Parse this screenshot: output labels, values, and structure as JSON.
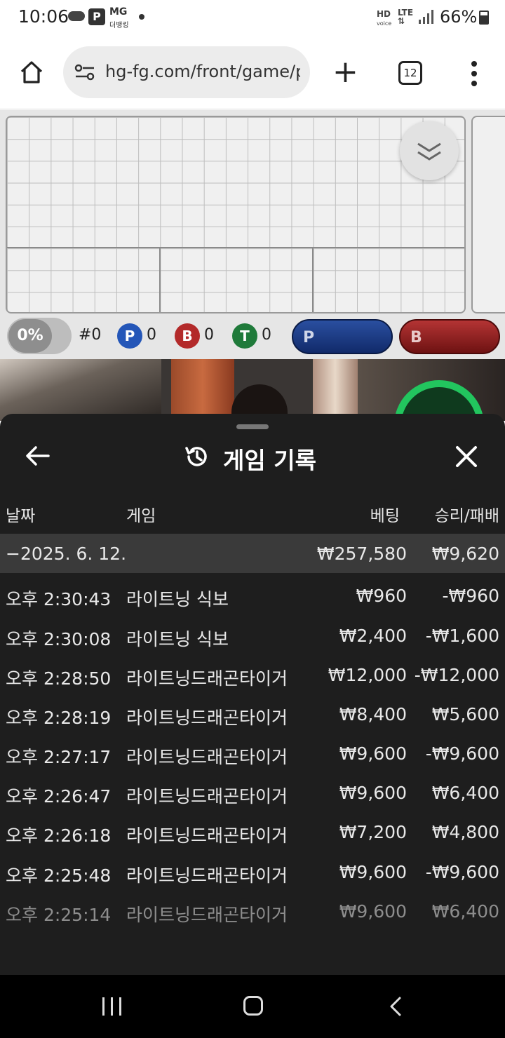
{
  "status_bar": {
    "time": "10:06",
    "app_badge": "P",
    "mg_label": "MG",
    "mg_sub": "더뱅킹",
    "hd_label": "HD",
    "hd_sub": "voice",
    "lte_label": "LTE",
    "battery": "66%"
  },
  "browser": {
    "url": "hg-fg.com/front/game/pla",
    "tab_count": "12"
  },
  "game_stats": {
    "percent": "0%",
    "round": "#0",
    "player_label": "P",
    "player_count": "0",
    "banker_label": "B",
    "banker_count": "0",
    "tie_label": "T",
    "tie_count": "0",
    "player_bet_label": "P",
    "banker_bet_label": "B"
  },
  "sheet": {
    "title": "게임 기록",
    "columns": {
      "date": "날짜",
      "game": "게임",
      "bet": "베팅",
      "win_loss": "승리/패배"
    },
    "summary": {
      "date": "−2025. 6. 12.",
      "bet": "₩257,580",
      "win_loss": "₩9,620"
    },
    "rows": [
      {
        "time": "오후 2:30:43",
        "game": "라이트닝 식보",
        "bet": "₩960",
        "win_loss": "-₩960"
      },
      {
        "time": "오후 2:30:08",
        "game": "라이트닝 식보",
        "bet": "₩2,400",
        "win_loss": "-₩1,600"
      },
      {
        "time": "오후 2:28:50",
        "game": "라이트닝드래곤타이거",
        "bet": "₩12,000",
        "win_loss": "-₩12,000"
      },
      {
        "time": "오후 2:28:19",
        "game": "라이트닝드래곤타이거",
        "bet": "₩8,400",
        "win_loss": "₩5,600"
      },
      {
        "time": "오후 2:27:17",
        "game": "라이트닝드래곤타이거",
        "bet": "₩9,600",
        "win_loss": "-₩9,600"
      },
      {
        "time": "오후 2:26:47",
        "game": "라이트닝드래곤타이거",
        "bet": "₩9,600",
        "win_loss": "₩6,400"
      },
      {
        "time": "오후 2:26:18",
        "game": "라이트닝드래곤타이거",
        "bet": "₩7,200",
        "win_loss": "₩4,800"
      },
      {
        "time": "오후 2:25:48",
        "game": "라이트닝드래곤타이거",
        "bet": "₩9,600",
        "win_loss": "-₩9,600"
      },
      {
        "time": "오후 2:25:14",
        "game": "라이트닝드래곤타이거",
        "bet": "₩9,600",
        "win_loss": "₩6,400"
      }
    ]
  },
  "colors": {
    "player": "#2456b8",
    "banker": "#b32a2a",
    "tie": "#1f7a3a",
    "sheet_bg": "#1e1e1e",
    "summary_bg": "#3a3a3a"
  }
}
